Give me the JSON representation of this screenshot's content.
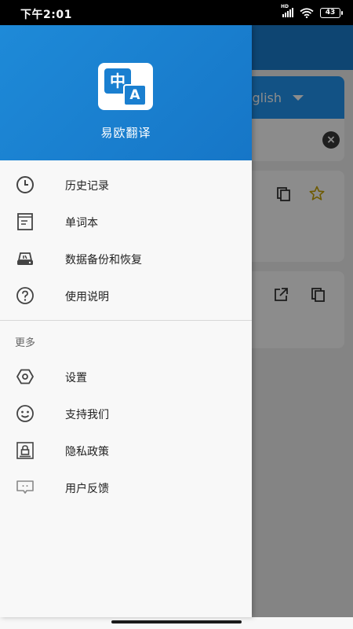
{
  "status_bar": {
    "time": "下午2:01",
    "battery": "43",
    "network": "HD"
  },
  "background": {
    "language_selector": "English",
    "colors": {
      "topbar": "#1a7fd0",
      "lang_bar": "#2196f3",
      "star": "#c9a400"
    }
  },
  "drawer": {
    "app_name": "易欧翻译",
    "logo": {
      "char_zh": "中",
      "char_en": "A"
    },
    "menu": [
      {
        "label": "历史记录",
        "icon": "history-clock-icon"
      },
      {
        "label": "单词本",
        "icon": "wordbook-icon"
      },
      {
        "label": "数据备份和恢复",
        "icon": "backup-drive-icon"
      },
      {
        "label": "使用说明",
        "icon": "help-circle-icon"
      }
    ],
    "more_section_title": "更多",
    "more_menu": [
      {
        "label": "设置",
        "icon": "settings-hexagon-icon"
      },
      {
        "label": "支持我们",
        "icon": "smile-icon"
      },
      {
        "label": "隐私政策",
        "icon": "privacy-lock-icon"
      },
      {
        "label": "用户反馈",
        "icon": "feedback-chat-icon"
      }
    ],
    "colors": {
      "header": "#1a7fd0",
      "icon": "#444444"
    }
  }
}
